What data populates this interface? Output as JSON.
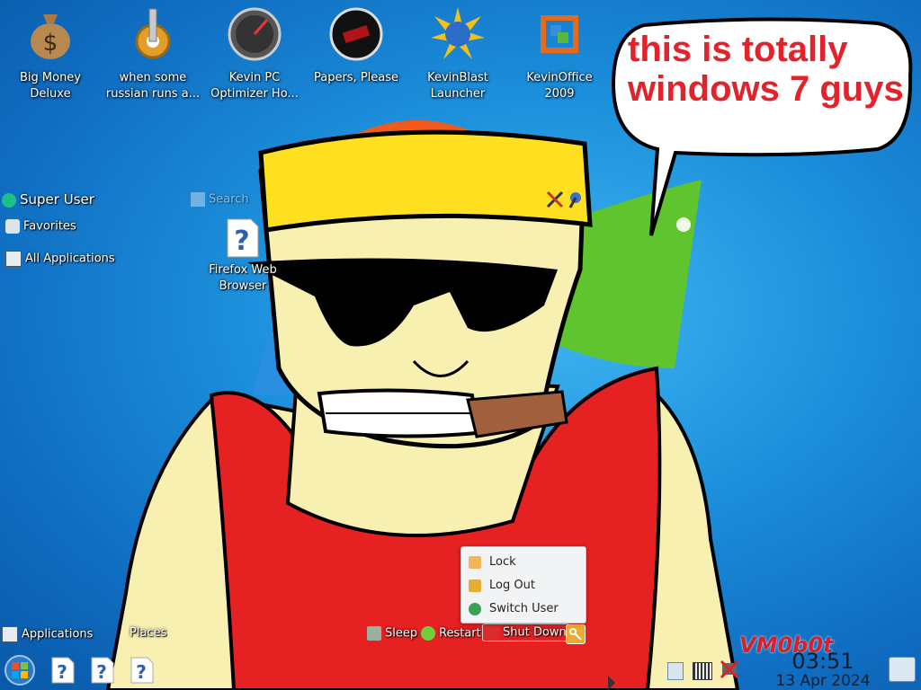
{
  "desktop": {
    "icons": [
      {
        "label": "Big Money\nDeluxe",
        "icon": "money-bag-icon"
      },
      {
        "label": "when some\nrussian runs a...",
        "icon": "gear-icon"
      },
      {
        "label": "Kevin PC\nOptimizer Ho...",
        "icon": "speedometer-icon"
      },
      {
        "label": "Papers, Please",
        "icon": "papers-please-icon"
      },
      {
        "label": "KevinBlast\nLauncher",
        "icon": "globe-burst-icon"
      },
      {
        "label": "KevinOffice\n2009",
        "icon": "office-logo-icon"
      }
    ],
    "file_icon_label": "Firefox Web\nBrowser"
  },
  "speech_bubble": {
    "line1": "this is totally",
    "line2": "windows 7 guys"
  },
  "launcher": {
    "user": "Super User",
    "search_placeholder": "Search",
    "favorites": "Favorites",
    "all_applications": "All Applications",
    "tab_applications": "Applications",
    "tab_places": "Places",
    "sleep": "Sleep",
    "restart": "Restart",
    "shut_down": "Shut Down"
  },
  "leave_menu": {
    "items": [
      "Lock",
      "Log Out",
      "Switch User"
    ]
  },
  "taskbar": {
    "watermark": "VM0b0t",
    "time": "03:51",
    "date": "13 Apr 2024"
  },
  "colors": {
    "bubble_text": "#e3232c",
    "shirt": "#e52121",
    "skin": "#f8f0b0",
    "bandana": "#ffe020"
  }
}
